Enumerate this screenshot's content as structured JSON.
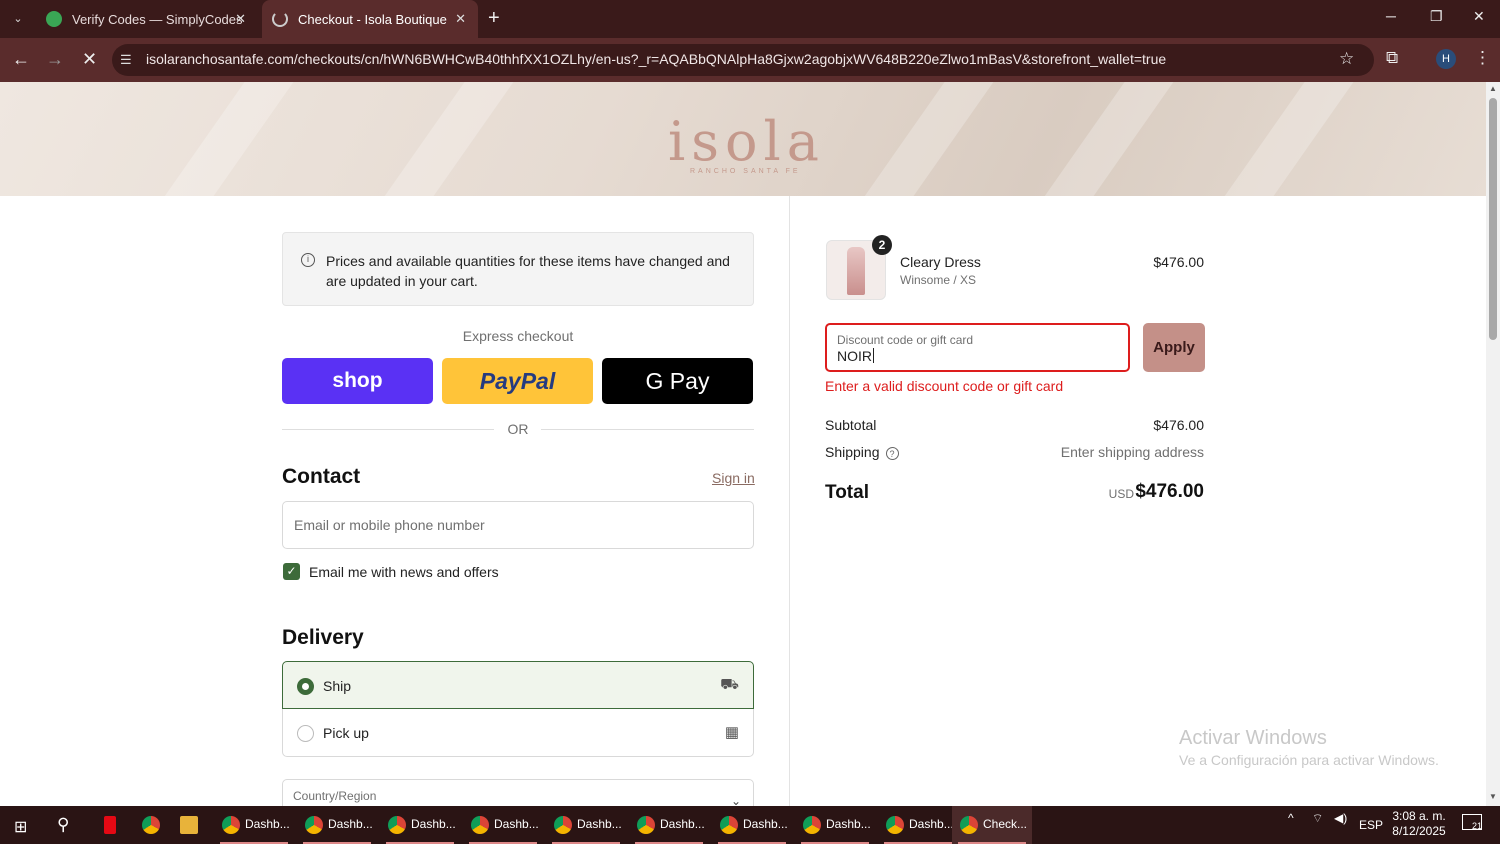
{
  "browser": {
    "tabs": [
      {
        "title": "Verify Codes — SimplyCodes",
        "icon": "simplycodes-icon"
      },
      {
        "title": "Checkout - Isola Boutique",
        "icon": "loading-icon"
      }
    ],
    "url": "isolaranchosantafe.com/checkouts/cn/hWN6BWHCwB40thhfXX1OZLhy/en-us?_r=AQABbQNAlpHa8Gjxw2agobjxWV648B220eZlwo1mBasV&storefront_wallet=true",
    "profile_initial": "H"
  },
  "header": {
    "logo": "isola",
    "logo_sub": "RANCHO SANTA FE"
  },
  "checkout": {
    "notice": "Prices and available quantities for these items have changed and are updated in your cart.",
    "express_label": "Express checkout",
    "shop_pay": "shop",
    "paypal": "PayPal",
    "gpay": "G Pay",
    "or": "OR",
    "contact_heading": "Contact",
    "sign_in": "Sign in",
    "email_placeholder": "Email or mobile phone number",
    "news_label": "Email me with news and offers",
    "news_checked": true,
    "delivery_heading": "Delivery",
    "ship_label": "Ship",
    "pickup_label": "Pick up",
    "country_label": "Country/Region"
  },
  "summary": {
    "item": {
      "name": "Cleary Dress",
      "variant": "Winsome / XS",
      "price": "$476.00",
      "quantity": "2"
    },
    "discount_label": "Discount code or gift card",
    "discount_value": "NOIR",
    "apply": "Apply",
    "error": "Enter a valid discount code or gift card",
    "subtotal_label": "Subtotal",
    "subtotal_value": "$476.00",
    "shipping_label": "Shipping",
    "shipping_value": "Enter shipping address",
    "total_label": "Total",
    "currency": "USD",
    "total_value": "$476.00"
  },
  "watermark": {
    "line1": "Activar Windows",
    "line2": "Ve a Configuración para activar Windows."
  },
  "taskbar": {
    "apps": [
      "Dashb...",
      "Dashb...",
      "Dashb...",
      "Dashb...",
      "Dashb...",
      "Dashb...",
      "Dashb...",
      "Dashb...",
      "Dashb...",
      "Check..."
    ],
    "lang": "ESP",
    "time": "3:08 a. m.",
    "date": "8/12/2025",
    "notifications": "21"
  }
}
